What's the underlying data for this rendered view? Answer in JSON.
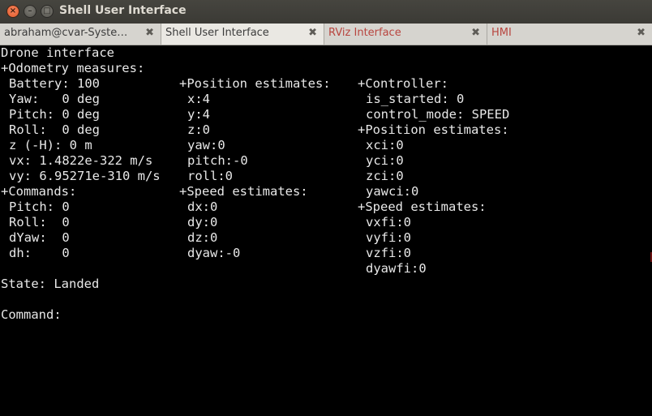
{
  "window": {
    "title": "Shell User Interface",
    "buttons": {
      "close": "×",
      "minimize": "–",
      "maximize": "□"
    }
  },
  "tabs": [
    {
      "label": "abraham@cvar-Syste…",
      "close": "✖",
      "active": false
    },
    {
      "label": "Shell User Interface",
      "close": "✖",
      "active": true
    },
    {
      "label": "RViz Interface",
      "close": "✖",
      "active": false
    },
    {
      "label": "HMI",
      "close": "✖",
      "active": false
    }
  ],
  "terminal": {
    "header": "Drone interface",
    "odometry": {
      "title": "+Odometry measures:",
      "lines": [
        "Battery: 100",
        "Yaw:   0 deg",
        "Pitch: 0 deg",
        "Roll:  0 deg",
        "z (-H): 0 m",
        "vx: 1.4822e-322 m/s",
        "vy: 6.95271e-310 m/s"
      ]
    },
    "commands": {
      "title": "+Commands:",
      "lines": [
        "Pitch: 0",
        "Roll:  0",
        "dYaw:  0",
        "dh:    0"
      ]
    },
    "position_estimates": {
      "title": "+Position estimates:",
      "lines": [
        "x:4",
        "y:4",
        "z:0",
        "yaw:0",
        "pitch:-0",
        "roll:0"
      ]
    },
    "speed_estimates": {
      "title": "+Speed estimates:",
      "lines": [
        "dx:0",
        "dy:0",
        "dz:0",
        "dyaw:-0"
      ]
    },
    "controller": {
      "title": "+Controller:",
      "lines": [
        "is_started: 0",
        "control_mode: SPEED"
      ]
    },
    "controller_position": {
      "title": "+Position estimates:",
      "lines": [
        "xci:0",
        "yci:0",
        "zci:0",
        "yawci:0"
      ]
    },
    "controller_speed": {
      "title": "+Speed estimates:",
      "lines": [
        "vxfi:0",
        "vyfi:0",
        "vzfi:0",
        "dyawfi:0"
      ]
    },
    "state": "State: Landed",
    "command_prompt": "Command:"
  },
  "colors": {
    "terminal_bg": "#000000",
    "terminal_fg": "#e8e8e8",
    "titlebar_bg": "#3c3b37",
    "tab_inactive_red": "#b8453f",
    "close_button": "#e95420"
  }
}
